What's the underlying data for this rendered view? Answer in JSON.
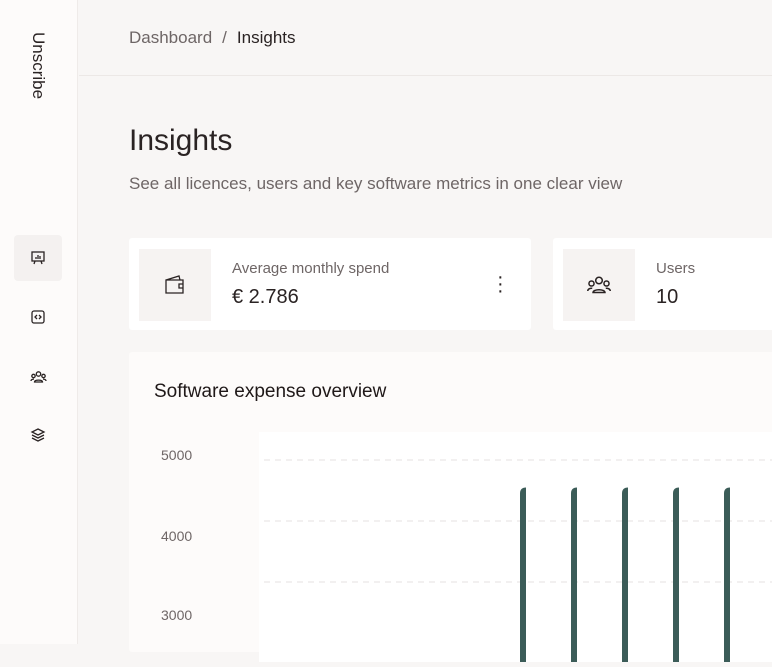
{
  "app": {
    "brand": "Unscribe"
  },
  "sidebar": {
    "items": [
      {
        "name": "insights",
        "icon": "presentation-chart-icon",
        "active": true
      },
      {
        "name": "code",
        "icon": "code-icon"
      },
      {
        "name": "users",
        "icon": "users-icon"
      },
      {
        "name": "layers",
        "icon": "layers-icon"
      }
    ]
  },
  "breadcrumb": {
    "parent": "Dashboard",
    "separator": "/",
    "current": "Insights"
  },
  "page": {
    "title": "Insights",
    "subtitle": "See all licences, users and key software metrics in one clear view"
  },
  "cards": [
    {
      "label": "Average monthly spend",
      "value": "€ 2.786",
      "icon": "wallet-icon"
    },
    {
      "label": "Users",
      "value": "10",
      "icon": "users-icon"
    }
  ],
  "chart_data": {
    "type": "bar",
    "title": "Software expense overview",
    "yticks": [
      "5000",
      "4000",
      "3000"
    ],
    "values": [
      4550,
      4550,
      4550,
      4550,
      4550,
      4550,
      4550,
      4550
    ],
    "ylim": [
      3000,
      5000
    ],
    "bar_color": "#3b5c58",
    "grid": "dashed"
  }
}
